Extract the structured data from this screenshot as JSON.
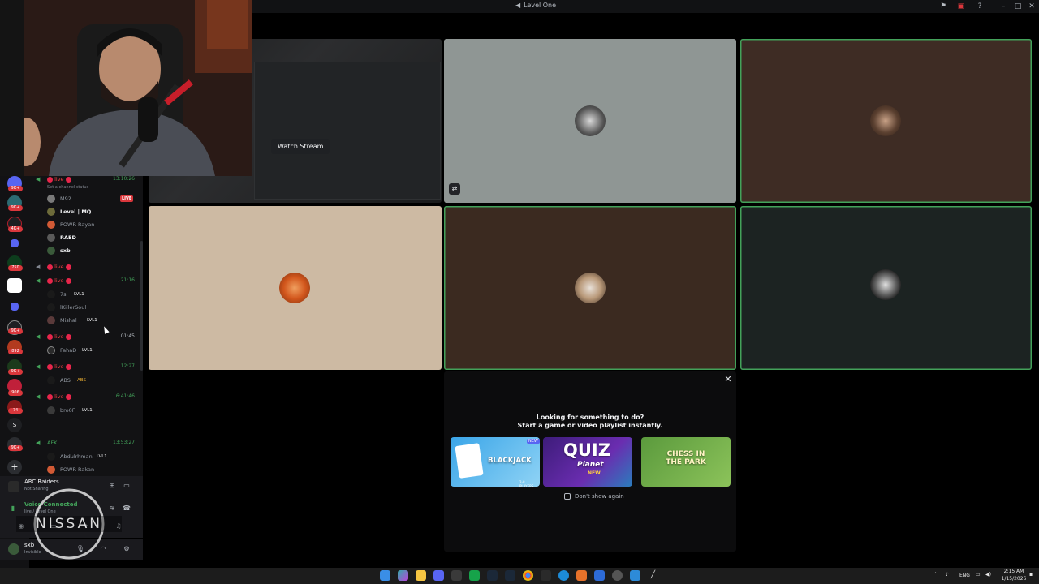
{
  "window": {
    "title": "Level One"
  },
  "stage": {
    "watch_stream_label": "Watch Stream"
  },
  "activity_prompt": {
    "line1": "Looking for something to do?",
    "line2": "Start a game or video playlist instantly.",
    "cards": [
      {
        "title": "BLACKJACK",
        "badge": "NEW",
        "subtitle": "2-8 PLAYERS"
      },
      {
        "title": "QUIZ",
        "subtitle": "Planet",
        "badge": "NEW"
      },
      {
        "title": "CHESS IN THE PARK"
      }
    ],
    "dont_show_label": "Don't show again"
  },
  "channels": {
    "status_hint": "Set a channel status",
    "groups": [
      {
        "name": "live",
        "timer": "13:10:26",
        "members": [
          "M92",
          "Level | MQ",
          "POWR Rayan",
          "RAED",
          "sxb"
        ],
        "live_member": "M92"
      },
      {
        "name": "live",
        "timer": "",
        "members": []
      },
      {
        "name": "live",
        "timer": "21:16",
        "members": [
          "7s",
          "lKillerSoul",
          "Mishal"
        ]
      },
      {
        "name": "live",
        "timer": "01:45",
        "members": [
          "FahaD"
        ]
      },
      {
        "name": "live",
        "timer": "12:27",
        "members": [
          "ABS"
        ]
      },
      {
        "name": "live",
        "timer": "6:41:46",
        "members": [
          "bro0F"
        ]
      }
    ],
    "afk": {
      "name": "AFK",
      "timer": "13:53:27",
      "members": [
        "Abdulrhman",
        "POWR Rakan"
      ]
    },
    "live_badge": "LIVE",
    "lvl_tag": "LVL1",
    "abs_tag": "ABS",
    "server_badges": [
      "9K+",
      "9K+",
      "4K+",
      "750",
      "9K+",
      "892",
      "9K+",
      "906",
      "74",
      "9K+"
    ]
  },
  "panels": {
    "game": "ARC Raiders",
    "game_status": "Not Sharing",
    "voice_status": "Voice Connected",
    "voice_channel": "live / Level One",
    "user_name": "sxb",
    "user_status": "Invisible"
  },
  "overlay": {
    "logo_text": "NISSAN"
  },
  "taskbar": {
    "lang": "ENG",
    "time": "2:15 AM",
    "date": "1/15/2026"
  },
  "colors": {
    "speaking_border": "#43a25a",
    "live_red": "#da373c",
    "voice_green": "#43a25a"
  }
}
